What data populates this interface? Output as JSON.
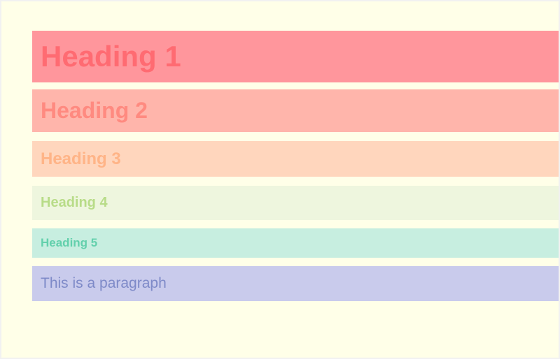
{
  "blocks": {
    "heading1": "Heading 1",
    "heading2": "Heading 2",
    "heading3": "Heading 3",
    "heading4": "Heading 4",
    "heading5": "Heading 5",
    "paragraph": "This is a paragraph"
  },
  "colors": {
    "page_background": "#ffffe8",
    "heading1_background": "#ff969c",
    "heading1_text": "#ff6b72",
    "heading2_background": "#ffb5ab",
    "heading2_text": "#ff8a80",
    "heading3_background": "#ffd6bd",
    "heading3_text": "#ffb487",
    "heading4_background": "#eef6de",
    "heading4_text": "#b8dc88",
    "heading5_background": "#c7eee0",
    "heading5_text": "#63d0ac",
    "paragraph_background": "#c9cbec",
    "paragraph_text": "#7e8ac8"
  }
}
